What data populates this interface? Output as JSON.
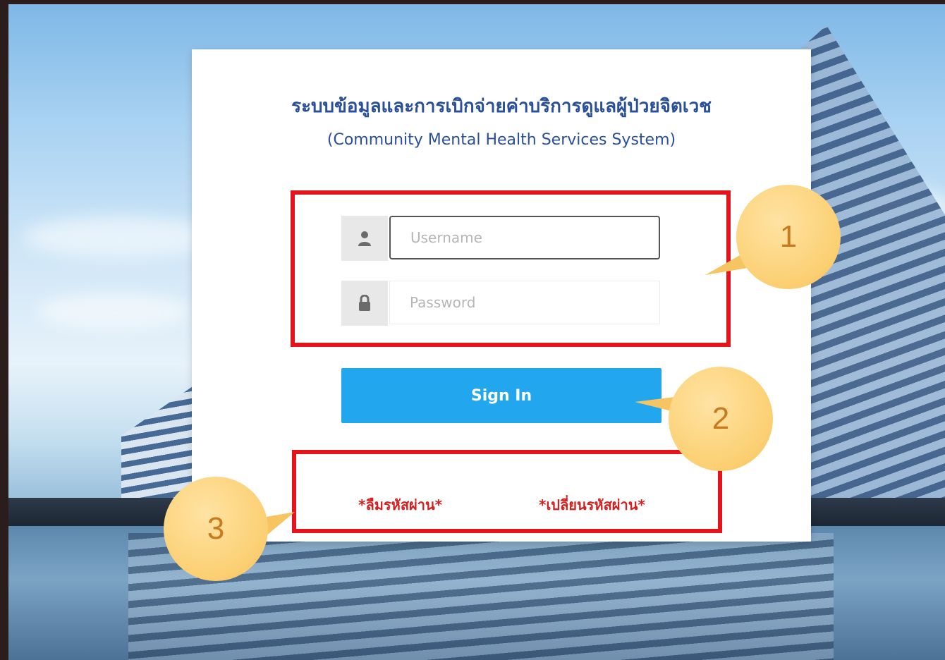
{
  "title_th": "ระบบข้อมูลและการเบิกจ่ายค่าบริการดูแลผู้ป่วยจิตเวช",
  "title_en": "(Community Mental Health Services System)",
  "username": {
    "placeholder": "Username",
    "value": ""
  },
  "password": {
    "placeholder": "Password",
    "value": ""
  },
  "sign_in_label": "Sign In",
  "links": {
    "forgot_password": "*ลืมรหัสผ่าน*",
    "change_password": "*เปลี่ยนรหัสผ่าน*"
  },
  "callouts": [
    "1",
    "2",
    "3"
  ],
  "colors": {
    "title": "#2a4f9a",
    "button": "#22a7ee",
    "link": "#d21f1f",
    "highlight": "#e3141b",
    "callout": "#fbcf72"
  },
  "icons": {
    "username": "user-icon",
    "password": "lock-icon"
  }
}
